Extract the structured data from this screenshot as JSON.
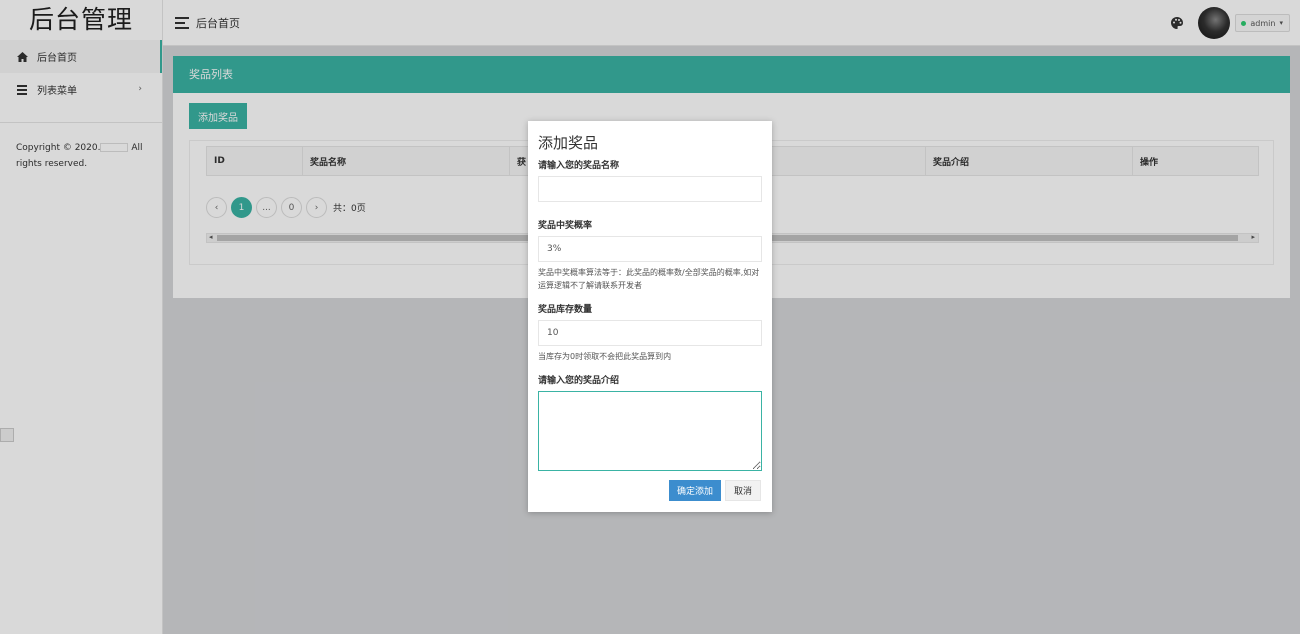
{
  "sidebar": {
    "logo": "后台管理",
    "items": [
      {
        "label": "后台首页",
        "icon": "home-icon",
        "active": true
      },
      {
        "label": "列表菜单",
        "icon": "list-icon",
        "has_submenu": true
      }
    ],
    "copyright_prefix": "Copyright © 2020.",
    "copyright_suffix": "All rights reserved."
  },
  "header": {
    "title": "后台首页",
    "user": "admin",
    "status_color": "#2ecc71"
  },
  "panel": {
    "title": "奖品列表",
    "add_button": "添加奖品",
    "columns": [
      "ID",
      "奖品名称",
      "获",
      "",
      "奖品介绍",
      "操作"
    ],
    "pagination": {
      "prev": "‹",
      "current": "1",
      "ellipsis": "...",
      "last": "0",
      "next": "›",
      "total": "共：0页"
    }
  },
  "modal": {
    "title": "添加奖品",
    "name_label": "请输入您的奖品名称",
    "name_value": "",
    "rate_label": "奖品中奖概率",
    "rate_value": "3%",
    "rate_help": "奖品中奖概率算法等于：此奖品的概率数/全部奖品的概率,如对运算逻辑不了解请联系开发者",
    "stock_label": "奖品库存数量",
    "stock_value": "10",
    "stock_help": "当库存为0时领取不会把此奖品算到内",
    "intro_label": "请输入您的奖品介绍",
    "confirm_button": "确定添加",
    "cancel_button": "取消"
  },
  "colors": {
    "accent": "#3ab3a4",
    "confirm": "#3c8dce"
  }
}
